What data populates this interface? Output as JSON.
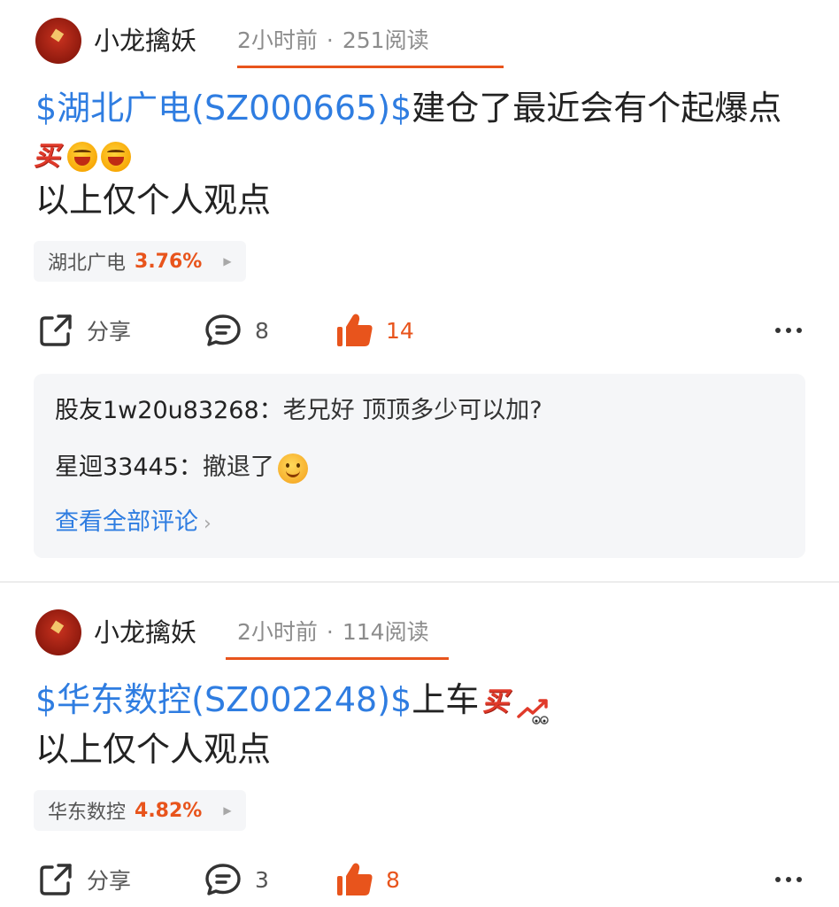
{
  "posts": [
    {
      "author": "小龙擒妖",
      "time": "2小时前",
      "reads": "251阅读",
      "content_link": "$湖北广电(SZ000665)$",
      "content_text": "建仓了最近会有个起爆点",
      "mai_label": "买",
      "content_line3": "以上仅个人观点",
      "stock": {
        "name": "湖北广电",
        "change": "3.76%"
      },
      "actions": {
        "share": "分享",
        "comments": "8",
        "likes": "14"
      },
      "comment_list": [
        {
          "author": "股友1w20u83268：",
          "text": "老兄好 顶顶多少可以加?"
        },
        {
          "author": "星迴33445：",
          "text": "撤退了"
        }
      ],
      "view_all": "查看全部评论"
    },
    {
      "author": "小龙擒妖",
      "time": "2小时前",
      "reads": "114阅读",
      "content_link": "$华东数控(SZ002248)$",
      "content_text": "上车",
      "mai_label": "买",
      "content_line3": "以上仅个人观点",
      "stock": {
        "name": "华东数控",
        "change": "4.82%"
      },
      "actions": {
        "share": "分享",
        "comments": "3",
        "likes": "8"
      }
    }
  ],
  "colors": {
    "link": "#2f7de1",
    "accent": "#e8541c",
    "underline": "#e8541c"
  },
  "icons": [
    "share-icon",
    "comment-icon",
    "thumbs-up-icon",
    "more-icon",
    "laughing-emoji-icon",
    "smile-emoji-icon",
    "trend-up-icon"
  ]
}
